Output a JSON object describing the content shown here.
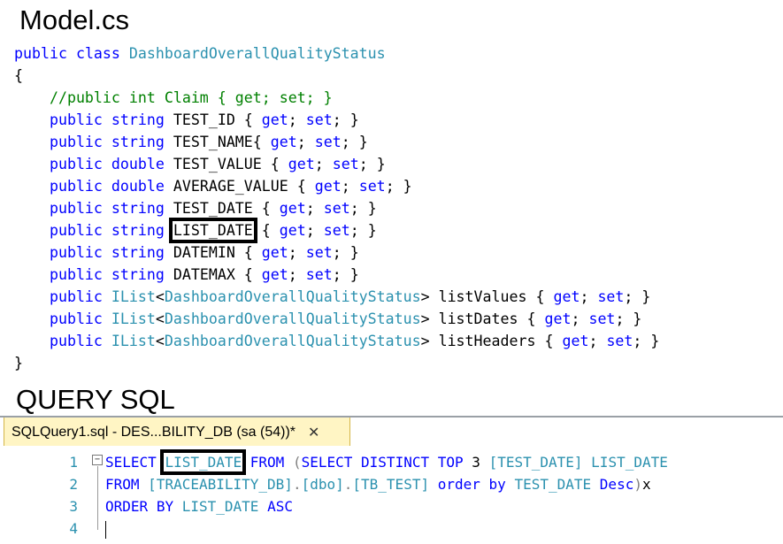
{
  "model_heading": "Model.cs",
  "model_code": {
    "class_decl": {
      "kw_public": "public",
      "kw_class": "class",
      "name": "DashboardOverallQualityStatus"
    },
    "open_brace": "{",
    "comment": "//public int Claim { get; set; }",
    "props": [
      {
        "kw": "public",
        "type": "string",
        "name": "TEST_ID",
        "sep": " { ",
        "get": "get",
        "set": "set",
        "end": "; }"
      },
      {
        "kw": "public",
        "type": "string",
        "name": "TEST_NAME",
        "sep": "{ ",
        "get": "get",
        "set": "set",
        "end": "; }"
      },
      {
        "kw": "public",
        "type": "double",
        "name": "TEST_VALUE",
        "sep": " { ",
        "get": "get",
        "set": "set",
        "end": "; }"
      },
      {
        "kw": "public",
        "type": "double",
        "name": "AVERAGE_VALUE",
        "sep": " { ",
        "get": "get",
        "set": "set",
        "end": "; }"
      },
      {
        "kw": "public",
        "type": "string",
        "name": "TEST_DATE",
        "sep": " { ",
        "get": "get",
        "set": "set",
        "end": "; }"
      },
      {
        "kw": "public",
        "type": "string",
        "name": "LIST_DATE",
        "sep": " { ",
        "get": "get",
        "set": "set",
        "end": "; }"
      },
      {
        "kw": "public",
        "type": "string",
        "name": "DATEMIN",
        "sep": " { ",
        "get": "get",
        "set": "set",
        "end": "; }"
      },
      {
        "kw": "public",
        "type": "string",
        "name": "DATEMAX",
        "sep": " { ",
        "get": "get",
        "set": "set",
        "end": "; }"
      }
    ],
    "lists": [
      {
        "kw": "public",
        "type": "IList",
        "generic": "DashboardOverallQualityStatus",
        "name": "listValues"
      },
      {
        "kw": "public",
        "type": "IList",
        "generic": "DashboardOverallQualityStatus",
        "name": "listDates"
      },
      {
        "kw": "public",
        "type": "IList",
        "generic": "DashboardOverallQualityStatus",
        "name": "listHeaders"
      }
    ],
    "close_brace": "}"
  },
  "sql_heading": "QUERY SQL",
  "sql_tab": {
    "title": "SQLQuery1.sql - DES...BILITY_DB (sa (54))*",
    "close": "✕"
  },
  "sql_editor": {
    "line_numbers": [
      "1",
      "2",
      "3",
      "4"
    ],
    "fold_symbol": "−",
    "line1": {
      "select": "SELECT",
      "col": "LIST_DATE",
      "from": "FROM",
      "paren": "(",
      "select2": "SELECT",
      "distinct": "DISTINCT",
      "top": "TOP",
      "num": "3",
      "col2": "[TEST_DATE]",
      "alias": "LIST_DATE"
    },
    "line2": {
      "from": "FROM",
      "db": "[TRACEABILITY_DB]",
      "dot1": ".",
      "schema": "[dbo]",
      "dot2": ".",
      "table": "[TB_TEST]",
      "order": "order",
      "by": "by",
      "col": "TEST_DATE",
      "desc": "Desc",
      "paren": ")",
      "alias": "x"
    },
    "line3": {
      "order": "ORDER",
      "by": "BY",
      "col": "LIST_DATE",
      "asc": "ASC"
    }
  },
  "colors": {
    "keyword": "#0000ff",
    "type": "#2b91af",
    "comment": "#008000",
    "operator": "#808080",
    "tab_active": "#fff5c4"
  }
}
